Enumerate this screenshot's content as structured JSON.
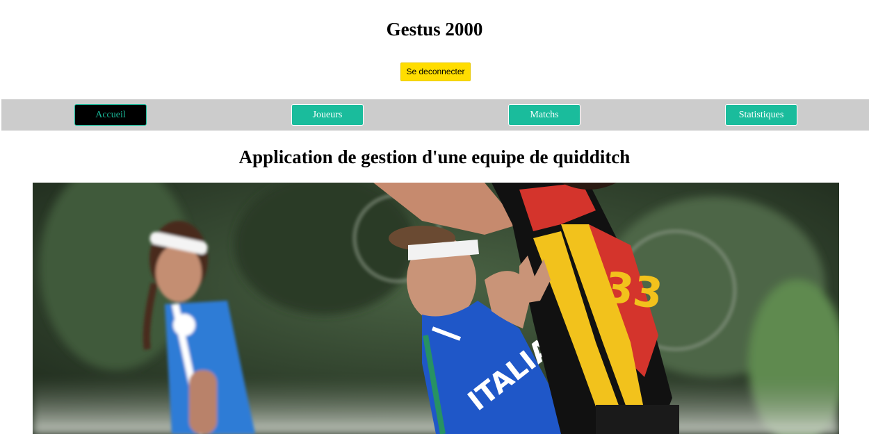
{
  "header": {
    "title": "Gestus 2000",
    "logout_label": "Se deconnecter",
    "logout_color": "#ffdd00"
  },
  "nav": {
    "items": [
      {
        "label": "Accueil",
        "active": true
      },
      {
        "label": "Joueurs",
        "active": false
      },
      {
        "label": "Matchs",
        "active": false
      },
      {
        "label": "Statistiques",
        "active": false
      }
    ],
    "bar_color": "#cccccc",
    "accent_color": "#1abc9c"
  },
  "main": {
    "heading": "Application de gestion d'une equipe de quidditch",
    "hero_image": {
      "jersey_text": "ITALIA",
      "jersey_number": "33"
    }
  }
}
